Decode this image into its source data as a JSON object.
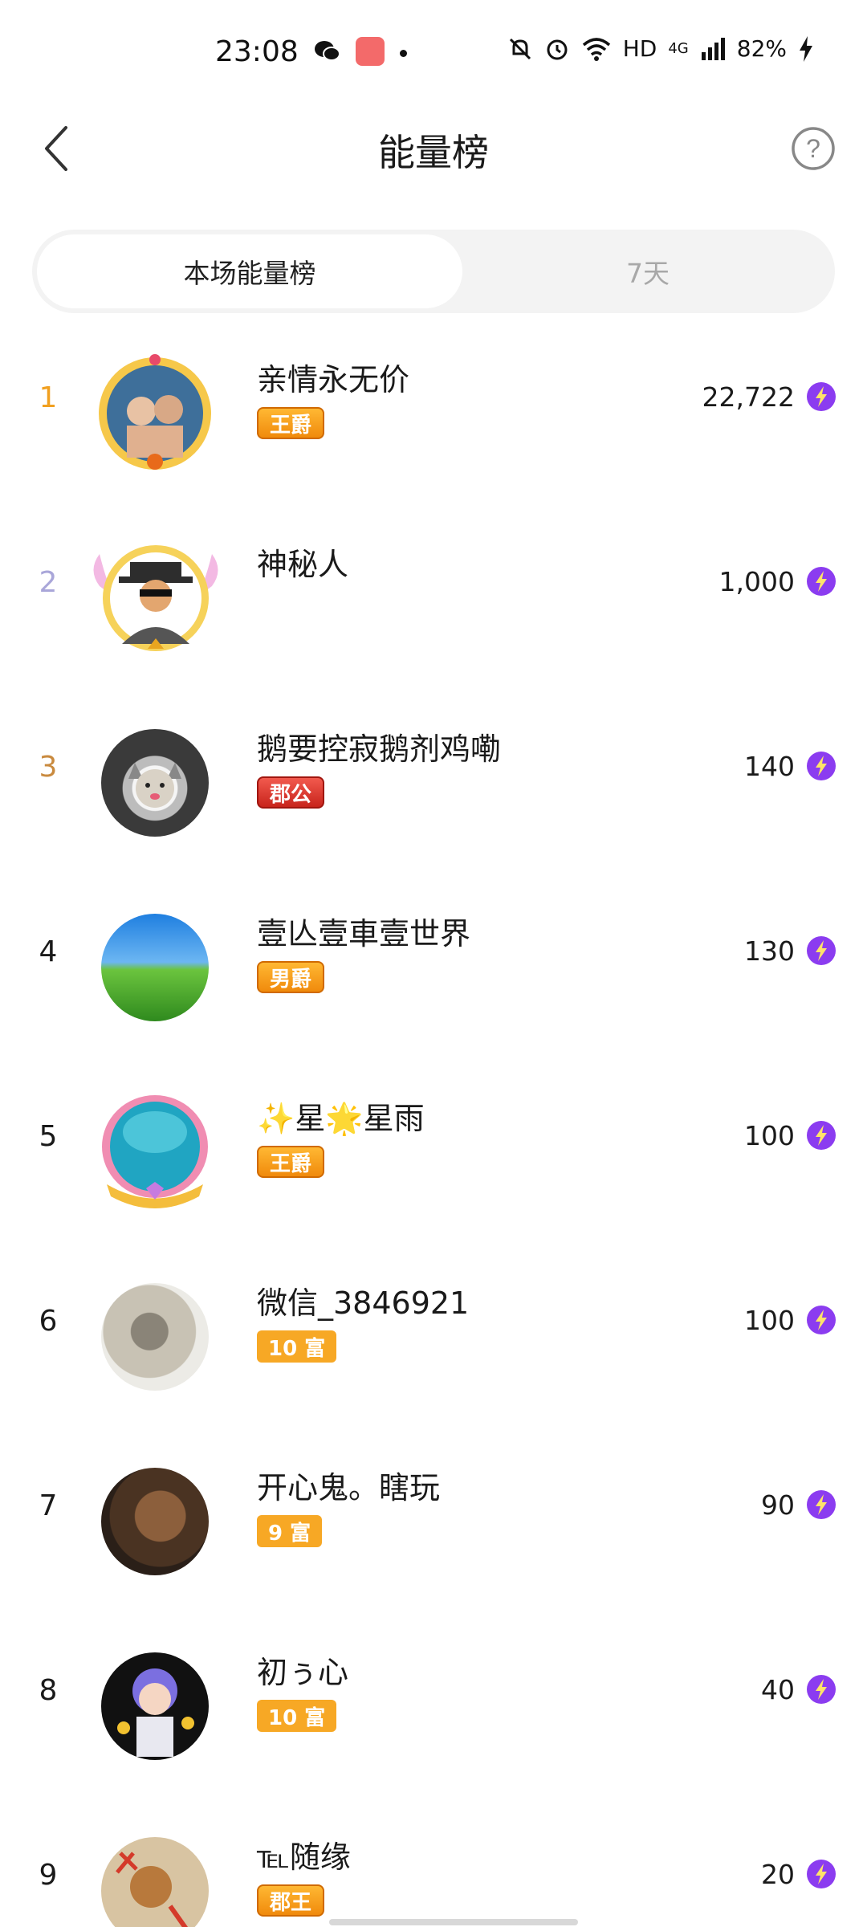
{
  "status_bar": {
    "time": "23:08",
    "hd": "HD",
    "network": "4G",
    "battery": "82%"
  },
  "header": {
    "title": "能量榜"
  },
  "tabs": [
    {
      "label": "本场能量榜",
      "active": true
    },
    {
      "label": "7天",
      "active": false
    }
  ],
  "ranking": [
    {
      "rank": "1",
      "name": "亲情永无价",
      "badge": "王爵",
      "score": "22,722"
    },
    {
      "rank": "2",
      "name": "神秘人",
      "badge": "",
      "score": "1,000"
    },
    {
      "rank": "3",
      "name": "鹅要控寂鹅剂鸡嘞",
      "badge": "郡公",
      "score": "140"
    },
    {
      "rank": "4",
      "name": "壹亾壹車壹世界",
      "badge": "男爵",
      "score": "130"
    },
    {
      "rank": "5",
      "name": "✨星🌟星雨",
      "badge": "王爵",
      "score": "100"
    },
    {
      "rank": "6",
      "name": "微信_3846921",
      "badge": "10 富",
      "score": "100"
    },
    {
      "rank": "7",
      "name": "开心鬼。瞎玩",
      "badge": "9 富",
      "score": "90"
    },
    {
      "rank": "8",
      "name": "初ぅ心",
      "badge": "10 富",
      "score": "40"
    },
    {
      "rank": "9",
      "name": "℡随缘",
      "badge": "郡王",
      "score": "20"
    }
  ],
  "colors": {
    "rank1": "#f1a020",
    "rank2": "#a9a6d9",
    "rank3": "#c98a3e",
    "energy_purple": "#8b3cf0"
  }
}
